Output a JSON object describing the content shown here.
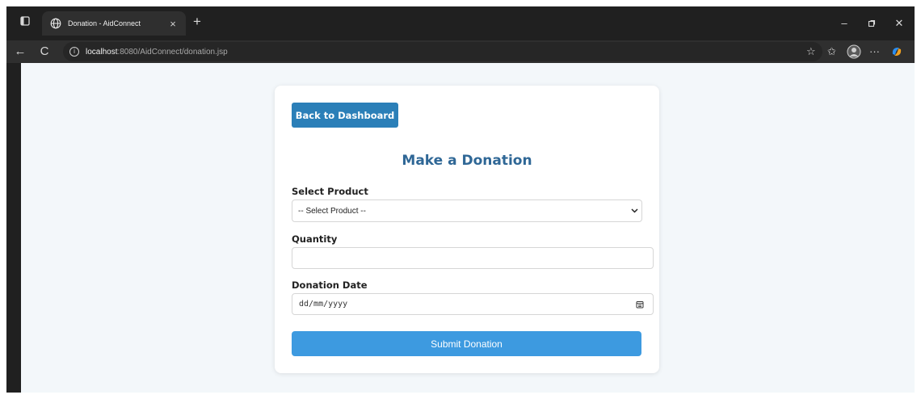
{
  "browser": {
    "tab_title": "Donation - AidConnect",
    "tab_close": "×",
    "new_tab": "+",
    "url_host": "localhost",
    "url_path": ":8080/AidConnect/donation.jsp",
    "window_minimize": "–",
    "window_maximize": "▢",
    "window_close": "✕",
    "back": "←",
    "reload": "C",
    "more": "···"
  },
  "page": {
    "back_button": "Back to Dashboard",
    "heading": "Make a Donation",
    "product_label": "Select Product",
    "product_selected": "-- Select Product --",
    "quantity_label": "Quantity",
    "quantity_value": "",
    "date_label": "Donation Date",
    "date_placeholder": "dd/mm/yyyy",
    "submit_button": "Submit Donation"
  },
  "colors": {
    "primary_button": "#2b7fb8",
    "submit_button": "#3d9ae0",
    "heading": "#2f6796",
    "page_background": "#f3f7fa"
  }
}
